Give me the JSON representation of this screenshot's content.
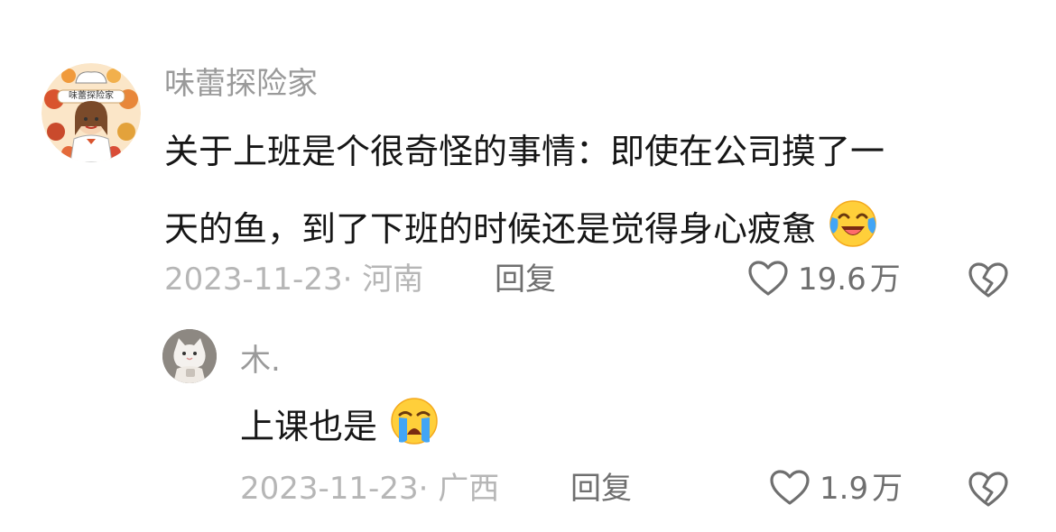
{
  "comments": [
    {
      "username": "味蕾探险家",
      "avatar_text": "味蕾探险家",
      "content_line1": "关于上班是个很奇怪的事情：即使在公司摸了一",
      "content_line2": "天的鱼，到了下班的时候还是觉得身心疲惫",
      "emoji": "crying-laughing-face",
      "date": "2023-11-23",
      "location": "· 河南",
      "reply_label": "回复",
      "likes": "19.6",
      "likes_unit": "万"
    },
    {
      "username": "木.",
      "content": "上课也是",
      "emoji": "loudly-crying-face",
      "date": "2023-11-23",
      "location": "· 广西",
      "reply_label": "回复",
      "likes": "1.9",
      "likes_unit": "万"
    }
  ]
}
